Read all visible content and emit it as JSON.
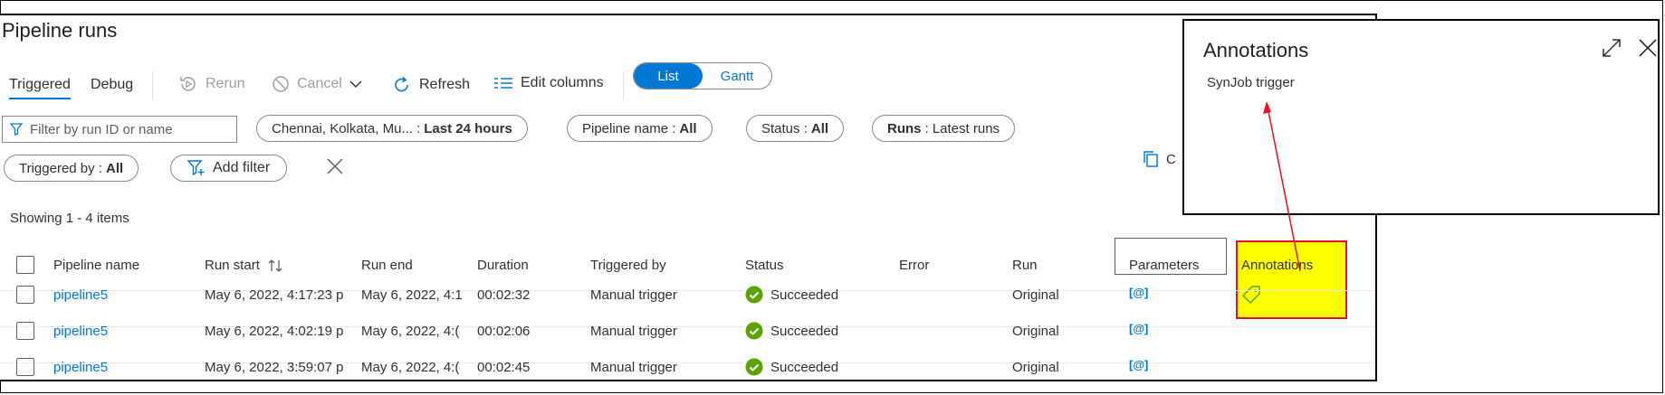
{
  "page": {
    "title": "Pipeline runs"
  },
  "toolbar": {
    "tabs": [
      {
        "label": "Triggered"
      },
      {
        "label": "Debug"
      }
    ],
    "rerun": "Rerun",
    "cancel": "Cancel",
    "refresh": "Refresh",
    "edit_columns": "Edit columns",
    "view_toggle": [
      {
        "label": "List"
      },
      {
        "label": "Gantt"
      }
    ]
  },
  "filters": {
    "search_placeholder": "Filter by run ID or name",
    "pills": [
      {
        "label": "Chennai, Kolkata, Mu...  :",
        "value": "Last 24 hours"
      },
      {
        "label": "Pipeline name :",
        "value": "All"
      },
      {
        "label": "Status :",
        "value": "All"
      },
      {
        "label": "Runs",
        "value": ": Latest runs"
      },
      {
        "label": "Triggered by :",
        "value": "All"
      }
    ],
    "add_filter": "Add filter"
  },
  "copy_fragment": "C",
  "table": {
    "showing": "Showing 1 - 4 items",
    "columns": [
      "Pipeline name",
      "Run start",
      "Run end",
      "Duration",
      "Triggered by",
      "Status",
      "Error",
      "Run",
      "Parameters",
      "Annotations"
    ],
    "rows": [
      {
        "name": "pipeline5",
        "start": "May 6, 2022, 4:17:23 p",
        "end": "May 6, 2022, 4:1",
        "duration": "00:02:32",
        "triggered_by": "Manual trigger",
        "status": "Succeeded",
        "run": "Original",
        "params": "[@]"
      },
      {
        "name": "pipeline5",
        "start": "May 6, 2022, 4:02:19 p",
        "end": "May 6, 2022, 4:(",
        "duration": "00:02:06",
        "triggered_by": "Manual trigger",
        "status": "Succeeded",
        "run": "Original",
        "params": "[@]"
      },
      {
        "name": "pipeline5",
        "start": "May 6, 2022, 3:59:07 p",
        "end": "May 6, 2022, 4:(",
        "duration": "00:02:45",
        "triggered_by": "Manual trigger",
        "status": "Succeeded",
        "run": "Original",
        "params": "[@]"
      }
    ]
  },
  "popup": {
    "title": "Annotations",
    "body": "SynJob trigger"
  },
  "colors": {
    "accent": "#0078d4",
    "success": "#57a300",
    "highlight": "#ffff00",
    "annotation_red": "#e81123"
  },
  "icons": [
    "rerun-icon",
    "cancel-icon",
    "chevron-down-icon",
    "refresh-icon",
    "edit-columns-icon",
    "filter-icon",
    "add-filter-icon",
    "close-icon",
    "sort-icon",
    "success-icon",
    "tag-icon",
    "expand-icon",
    "copy-icon"
  ]
}
